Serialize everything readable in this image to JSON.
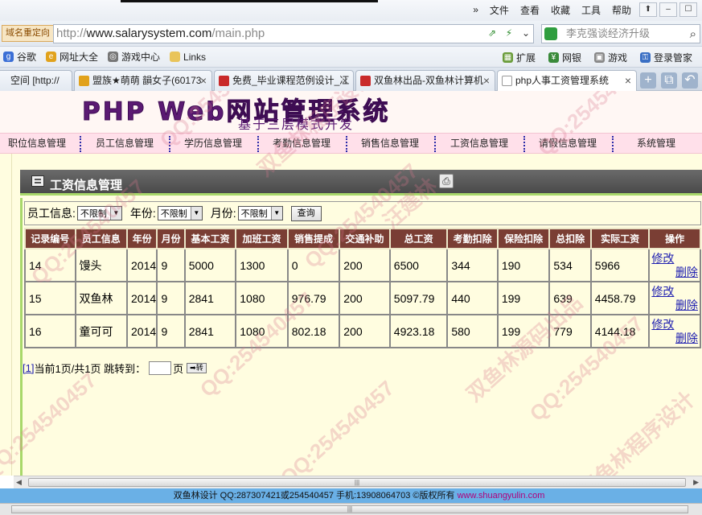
{
  "browser": {
    "menu": [
      "文件",
      "查看",
      "收藏",
      "工具",
      "帮助"
    ],
    "redirect_label": "域名重定向",
    "url_prefix": "http://",
    "url_host": "www.salarysystem.com",
    "url_path": "/main.php",
    "search_placeholder": "李克强谈经济升级",
    "favorites": [
      "谷歌",
      "网址大全",
      "游戏中心",
      "Links"
    ],
    "favorites_right": [
      "扩展",
      "网银",
      "游戏",
      "登录管家"
    ],
    "tabs": [
      {
        "label": "空间 [http://"
      },
      {
        "label": "盟族★萌萌 韻女子(60173"
      },
      {
        "label": "免费_毕业课程范例设计_冮"
      },
      {
        "label": "双鱼林出品-双鱼林计算机"
      },
      {
        "label": "php人事工资管理系统"
      }
    ]
  },
  "site": {
    "title": "PHP Web网站管理系统",
    "subtitle": "基于三层模式开发",
    "nav": [
      "职位信息管理",
      "员工信息管理",
      "学历信息管理",
      "考勤信息管理",
      "销售信息管理",
      "工资信息管理",
      "请假信息管理",
      "系统管理"
    ]
  },
  "panel": {
    "title": "工资信息管理",
    "filter": {
      "employee_label": "员工信息:",
      "employee_value": "不限制",
      "year_label": "年份:",
      "year_value": "不限制",
      "month_label": "月份:",
      "month_value": "不限制",
      "query_button": "查询"
    },
    "columns": [
      "记录编号",
      "员工信息",
      "年份",
      "月份",
      "基本工资",
      "加班工资",
      "销售提成",
      "交通补助",
      "总工资",
      "考勤扣除",
      "保险扣除",
      "总扣除",
      "实际工资",
      "操作"
    ],
    "rows": [
      {
        "id": "14",
        "employee": "馒头",
        "year": "2014",
        "month": "9",
        "base": "5000",
        "overtime": "1300",
        "commission": "0",
        "transport": "200",
        "total": "6500",
        "attendance_deduct": "344",
        "insurance_deduct": "190",
        "total_deduct": "534",
        "actual": "5966"
      },
      {
        "id": "15",
        "employee": "双鱼林",
        "year": "2014",
        "month": "9",
        "base": "2841",
        "overtime": "1080",
        "commission": "976.79",
        "transport": "200",
        "total": "5097.79",
        "attendance_deduct": "440",
        "insurance_deduct": "199",
        "total_deduct": "639",
        "actual": "4458.79"
      },
      {
        "id": "16",
        "employee": "童可可",
        "year": "2014",
        "month": "9",
        "base": "2841",
        "overtime": "1080",
        "commission": "802.18",
        "transport": "200",
        "total": "4923.18",
        "attendance_deduct": "580",
        "insurance_deduct": "199",
        "total_deduct": "779",
        "actual": "4144.18"
      }
    ],
    "edit_label": "修改",
    "delete_label": "删除",
    "pager": {
      "page_link": "[1]",
      "status": "当前1页/共1页 跳转到：",
      "page_unit": "页",
      "go_button": "➡转"
    }
  },
  "footer": {
    "text": "双鱼林设计 QQ:287307421或254540457 手机:13908064703 ©版权所有 ",
    "site_link": "www.shuangyulin.com"
  },
  "watermark": {
    "qq": "QQ:254540457",
    "name": "汪建林",
    "name2": "双鱼林源码出品",
    "name3": "双鱼林程序设计"
  }
}
